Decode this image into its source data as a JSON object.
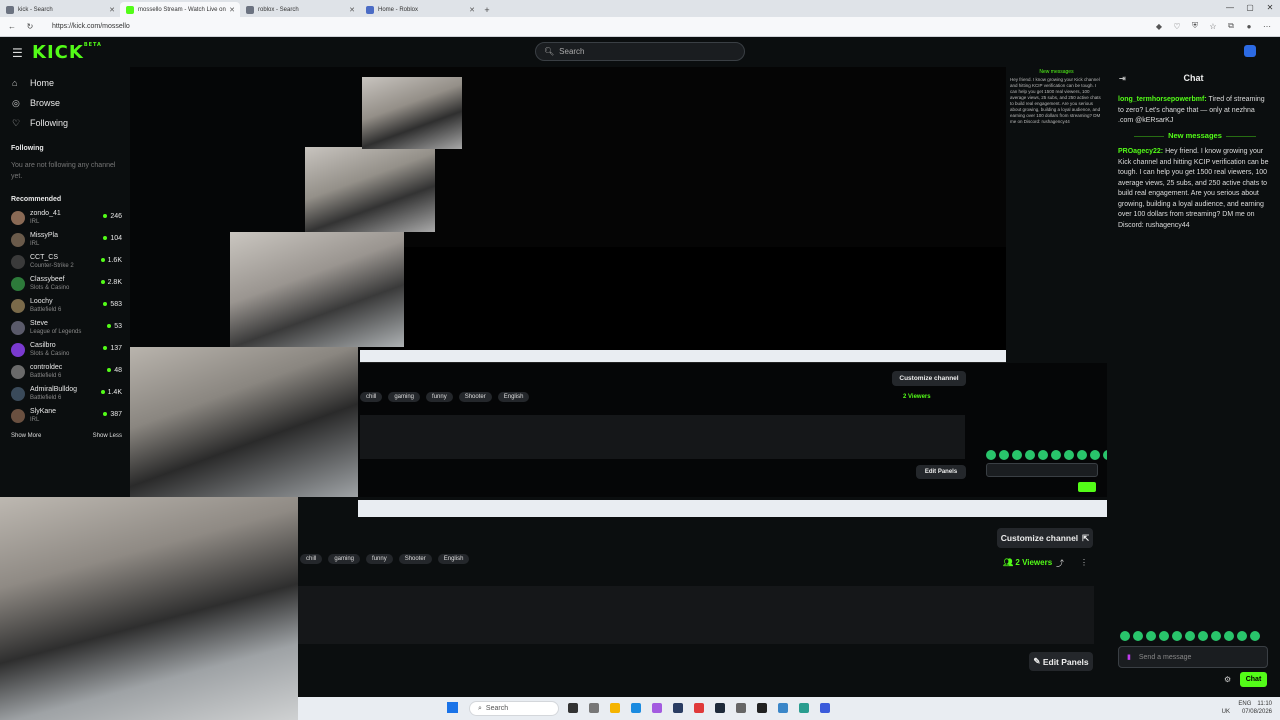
{
  "browser": {
    "tabs": [
      {
        "label": "kick - Search",
        "active": false
      },
      {
        "label": "mossello Stream - Watch Live on",
        "active": true
      },
      {
        "label": "roblox - Search",
        "active": false
      },
      {
        "label": "Home - Roblox",
        "active": false
      }
    ],
    "url": "https://kick.com/mossello"
  },
  "header": {
    "logo": "KICK",
    "logo_badge": "BETA",
    "search_placeholder": "Search"
  },
  "sidebar": {
    "nav": [
      {
        "label": "Home",
        "icon": "home-icon"
      },
      {
        "label": "Browse",
        "icon": "compass-icon"
      },
      {
        "label": "Following",
        "icon": "heart-icon"
      }
    ],
    "following_title": "Following",
    "following_empty": "You are not following any channel yet.",
    "recommended_title": "Recommended",
    "recommended": [
      {
        "name": "zondo_41",
        "category": "IRL",
        "viewers": "246"
      },
      {
        "name": "MissyPla",
        "category": "IRL",
        "viewers": "104"
      },
      {
        "name": "CCT_CS",
        "category": "Counter-Strike 2",
        "viewers": "1.6K"
      },
      {
        "name": "Classybeef",
        "category": "Slots & Casino",
        "viewers": "2.8K"
      },
      {
        "name": "Loochy",
        "category": "Battlefield 6",
        "viewers": "583"
      },
      {
        "name": "Steve",
        "category": "League of Legends",
        "viewers": "53"
      },
      {
        "name": "Casilbro",
        "category": "Slots & Casino",
        "viewers": "137"
      },
      {
        "name": "controldec",
        "category": "Battlefield 6",
        "viewers": "48"
      },
      {
        "name": "AdmiralBulldog",
        "category": "Battlefield 6",
        "viewers": "1.4K"
      },
      {
        "name": "SlyKane",
        "category": "IRL",
        "viewers": "387"
      }
    ],
    "show_more": "Show More",
    "show_less": "Show Less"
  },
  "stream_info": {
    "tags": [
      "chill",
      "gaming",
      "funny",
      "Shooter",
      "English"
    ],
    "customize": "Customize channel",
    "viewers": "2 Viewers",
    "edit_panels": "Edit Panels"
  },
  "chat": {
    "title": "Chat",
    "new_messages": "New messages",
    "messages": [
      {
        "user": "long_termhorsepowerbmf:",
        "text": "Tired of streaming to zero? Let's change that — only at nezhna .com @kERsarKJ"
      },
      {
        "user": "PROagecy22:",
        "text": "Hey friend. I know growing your Kick channel and hitting KCIP verification can be tough. I can help you get 1500 real viewers, 100 average views, 25 subs, and 250 active chats to build real engagement. Are you serious about growing, building a loyal audience, and earning over 100 dollars from streaming? DM me on Discord: rushagency44"
      }
    ],
    "send_placeholder": "Send a message",
    "send_button": "Chat"
  },
  "taskbar": {
    "search": "Search",
    "lang": "ENG",
    "region": "UK",
    "time": "11:10",
    "date": "07/08/2026"
  },
  "colors": {
    "accent": "#53fc18",
    "bg": "#0b0e0f"
  }
}
